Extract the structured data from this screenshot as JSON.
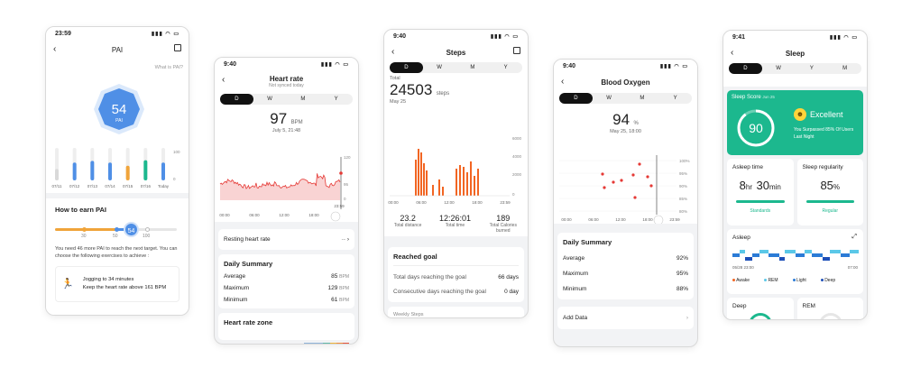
{
  "pai": {
    "time": "23:59",
    "title": "PAI",
    "what": "What is PAI?",
    "score": "54",
    "score_unit": "PAI",
    "scale_max": "100",
    "scale_min": "0",
    "days": [
      "07/11",
      "07/12",
      "07/13",
      "07/14",
      "07/15",
      "07/16",
      "Today"
    ],
    "bars": [
      0.35,
      0.55,
      0.6,
      0.55,
      0.45,
      0.62,
      0.55
    ],
    "earn_title": "How to earn PAI",
    "slider_labels": [
      "30",
      "50",
      "100"
    ],
    "slider_value": "54",
    "hint": "You need 46 more PAI to reach the next target. You can choose the following exercises to achieve :",
    "exercise": "Jogging to 34 minutes",
    "exercise_detail": "Keep the heart rate above 161 BPM"
  },
  "heart": {
    "time": "9:40",
    "title": "Heart rate",
    "subtitle": "Not synced today",
    "tabs": [
      "D",
      "W",
      "M",
      "Y"
    ],
    "value": "97",
    "unit": "BPM",
    "datetime": "July 5, 21:48",
    "yticks": [
      "120",
      "95",
      "0"
    ],
    "xticks": [
      "00:00",
      "06:00",
      "12:00",
      "18:00",
      "23:59"
    ],
    "resting": "Resting heart rate",
    "resting_value": "--",
    "summary_title": "Daily Summary",
    "summary": [
      {
        "label": "Average",
        "value": "85",
        "unit": "BPM"
      },
      {
        "label": "Maximum",
        "value": "129",
        "unit": "BPM"
      },
      {
        "label": "Minimum",
        "value": "61",
        "unit": "BPM"
      }
    ],
    "zone_title": "Heart rate zone"
  },
  "steps": {
    "time": "9:40",
    "title": "Steps",
    "tabs": [
      "D",
      "W",
      "M",
      "Y"
    ],
    "total_label": "Total",
    "value": "24503",
    "unit": "steps",
    "date": "May 25",
    "yticks": [
      "6000",
      "4000",
      "2000",
      "0"
    ],
    "xticks": [
      "00:00",
      "06:00",
      "12:00",
      "18:00",
      "23:59"
    ],
    "stats": [
      {
        "value": "23.2",
        "label": "Total distance"
      },
      {
        "value": "12:26:01",
        "label": "Total time"
      },
      {
        "value": "189",
        "label": "Total Calories burned"
      }
    ],
    "goal_title": "Reached goal",
    "goals": [
      {
        "label": "Total days reaching the goal",
        "value": "66 days"
      },
      {
        "label": "Consecutive days reaching the goal",
        "value": "0 day"
      }
    ],
    "weekly": "Weekly Steps"
  },
  "oxygen": {
    "time": "9:40",
    "title": "Blood Oxygen",
    "tabs": [
      "D",
      "W",
      "M",
      "Y"
    ],
    "value": "94",
    "unit": "%",
    "datetime": "May 25, 18:00",
    "yticks": [
      "100%",
      "95%",
      "90%",
      "85%",
      "80%"
    ],
    "xticks": [
      "00:00",
      "06:00",
      "12:00",
      "18:00",
      "23:59"
    ],
    "summary_title": "Daily Summary",
    "summary": [
      {
        "label": "Average",
        "value": "92%"
      },
      {
        "label": "Maximum",
        "value": "95%"
      },
      {
        "label": "Minimum",
        "value": "88%"
      }
    ],
    "add": "Add Data"
  },
  "sleep": {
    "time": "9:41",
    "title": "Sleep",
    "tabs": [
      "D",
      "W",
      "Y",
      "M"
    ],
    "score_label": "Sleep Score",
    "score_date": "Jun 25",
    "score": "90",
    "rating": "Excellent",
    "rating_detail": "You Surpassed 85% Of Users Last Night",
    "asleep_title": "Asleep time",
    "hours": "8",
    "hours_unit": "hr",
    "mins": "30",
    "mins_unit": "min",
    "asleep_status": "Standards",
    "reg_title": "Sleep regularity",
    "reg_value": "85",
    "reg_unit": "%",
    "reg_status": "Regular",
    "asleep_chart": "Asleep",
    "start": "05/28 23:00",
    "end": "07:00",
    "legend": [
      "Awake",
      "REM",
      "Light",
      "Deep"
    ],
    "deep": "Deep",
    "rem": "REM",
    "colors": {
      "awake": "#f26522",
      "rem": "#5bc8e8",
      "light": "#2b7bd6",
      "deep": "#1d4fb8",
      "accent": "#1cb88e"
    }
  }
}
